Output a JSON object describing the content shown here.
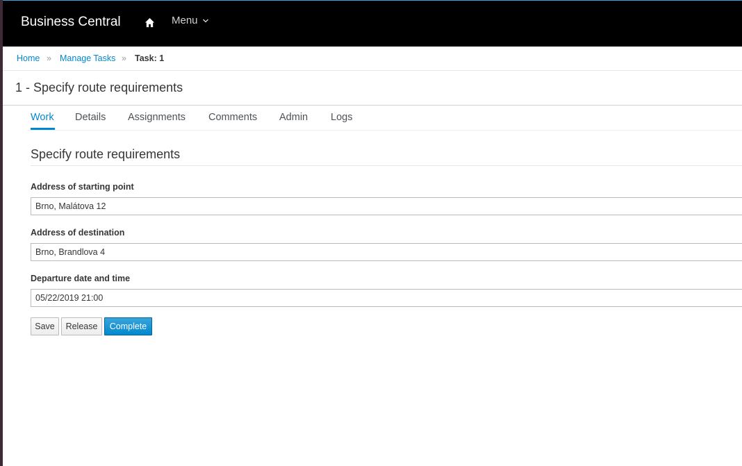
{
  "app": {
    "title": "Business Central",
    "menu_label": "Menu",
    "home_icon": "home-icon",
    "menu_icon": "chevron-down-icon"
  },
  "breadcrumb": {
    "home": "Home",
    "manage_tasks": "Manage Tasks",
    "current": "Task: 1",
    "separator": "»"
  },
  "page": {
    "title": "1 - Specify route requirements"
  },
  "tabs": [
    {
      "label": "Work",
      "active": true
    },
    {
      "label": "Details",
      "active": false
    },
    {
      "label": "Assignments",
      "active": false
    },
    {
      "label": "Comments",
      "active": false
    },
    {
      "label": "Admin",
      "active": false
    },
    {
      "label": "Logs",
      "active": false
    }
  ],
  "form": {
    "title": "Specify route requirements",
    "fields": [
      {
        "label": "Address of starting point",
        "value": "Brno, Malátova 12"
      },
      {
        "label": "Address of destination",
        "value": "Brno, Brandlova 4"
      },
      {
        "label": "Departure date and time",
        "value": "05/22/2019 21:00"
      }
    ]
  },
  "buttons": {
    "save": "Save",
    "release": "Release",
    "complete": "Complete"
  },
  "colors": {
    "accent": "#0088ce",
    "topbar": "#000000"
  }
}
